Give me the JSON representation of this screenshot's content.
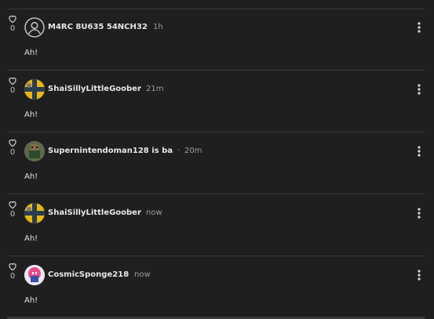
{
  "comments": [
    {
      "author": "M4RC 8U635 54NCH32",
      "time": "1h",
      "text": "Ah!",
      "likes": "0",
      "avatar": "person-placeholder"
    },
    {
      "author": "ShaiSillyLittleGoober",
      "time": "21m",
      "text": "Ah!",
      "likes": "0",
      "avatar": "yellow-flag"
    },
    {
      "author": "Supernintendoman128 is ba…",
      "time": "20m",
      "text": "Ah!",
      "likes": "0",
      "avatar": "pixel-character"
    },
    {
      "author": "ShaiSillyLittleGoober",
      "time": "now",
      "text": "Ah!",
      "likes": "0",
      "avatar": "yellow-flag"
    },
    {
      "author": "CosmicSponge218",
      "time": "now",
      "text": "Ah!",
      "likes": "0",
      "avatar": "pink-character"
    }
  ],
  "separator": "·",
  "colors": {
    "background": "#1f1f1f",
    "divider": "#3a3a3a",
    "text": "#e6e6e6",
    "muted": "#9e9e9e"
  }
}
